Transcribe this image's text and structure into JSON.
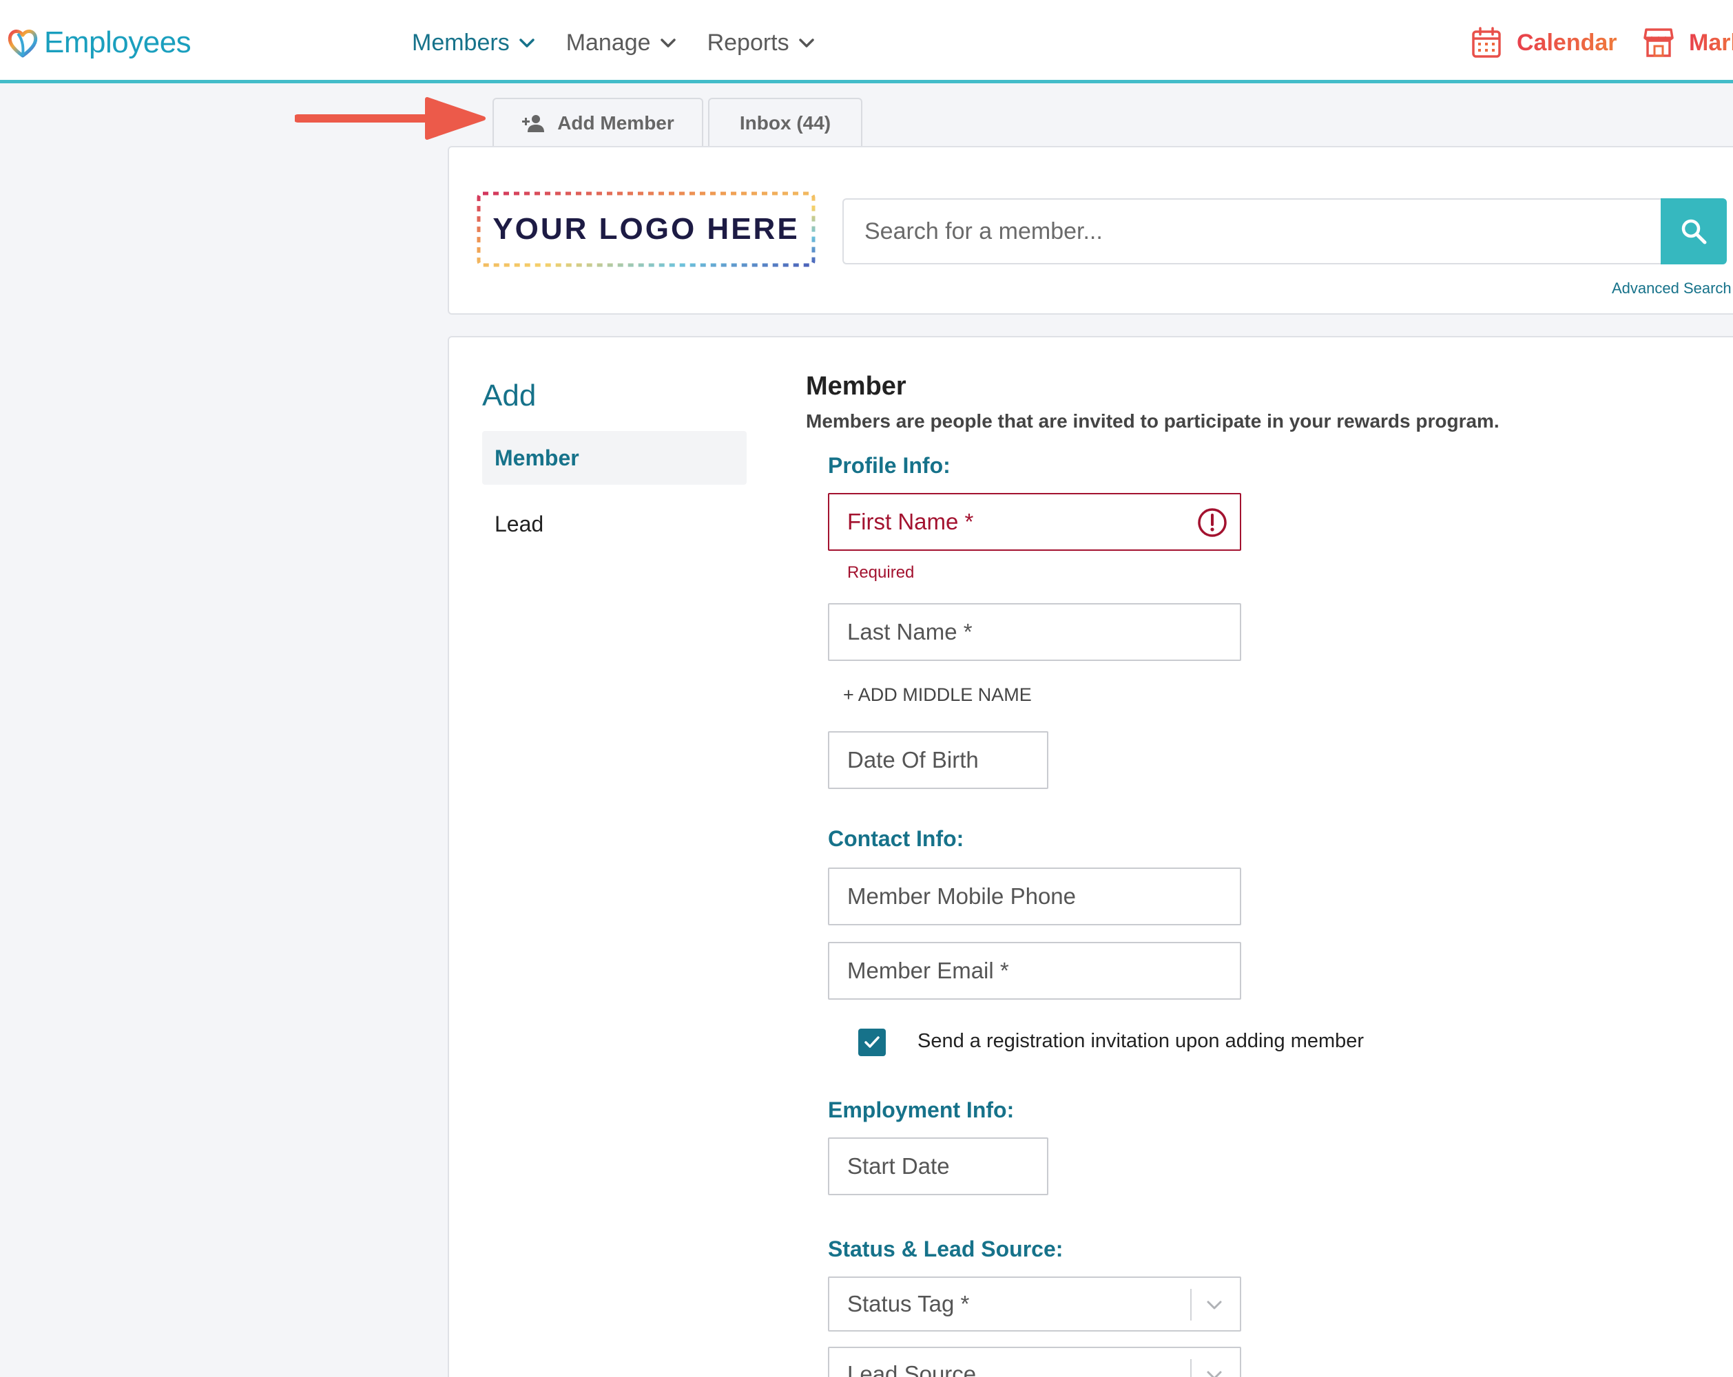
{
  "brand": {
    "name": "Employees"
  },
  "nav": {
    "items": [
      {
        "label": "Members"
      },
      {
        "label": "Manage"
      },
      {
        "label": "Reports"
      }
    ],
    "calendar_label": "Calendar",
    "market_label": "Mark"
  },
  "tabs": {
    "add_member": "Add Member",
    "inbox": "Inbox (44)"
  },
  "header": {
    "logo_text": "YOUR LOGO HERE",
    "search_placeholder": "Search for a member...",
    "advanced_search": "Advanced Search"
  },
  "sidebar": {
    "title": "Add",
    "items": [
      {
        "label": "Member",
        "active": true
      },
      {
        "label": "Lead",
        "active": false
      }
    ]
  },
  "form": {
    "title": "Member",
    "description": "Members are people that are invited to participate in your rewards program.",
    "sections": {
      "profile": "Profile Info:",
      "contact": "Contact Info:",
      "employment": "Employment Info:",
      "status": "Status & Lead Source:"
    },
    "fields": {
      "first_name": "First Name *",
      "first_name_error": "Required",
      "last_name": "Last Name *",
      "add_middle_name": "+ ADD MIDDLE NAME",
      "date_of_birth": "Date Of Birth",
      "mobile_phone": "Member Mobile Phone",
      "email": "Member Email *",
      "send_invitation": "Send a registration invitation upon adding member",
      "start_date": "Start Date",
      "status_tag": "Status Tag *",
      "lead_source": "Lead Source"
    },
    "send_invitation_checked": true
  },
  "colors": {
    "accent": "#16728a",
    "brand_teal": "#43bcc9",
    "search_button": "#36b8bf",
    "error": "#a3122f",
    "annotation_arrow": "#ec5a4a"
  }
}
